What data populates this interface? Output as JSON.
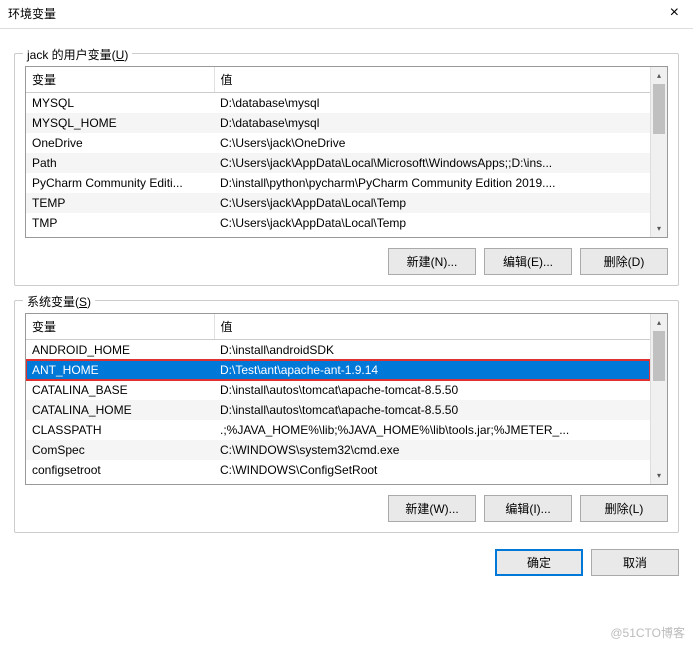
{
  "window": {
    "title": "环境变量",
    "close_label": "×"
  },
  "user_section": {
    "title_prefix": "jack 的用户变量(",
    "title_hotkey": "U",
    "title_suffix": ")",
    "headers": {
      "name": "变量",
      "value": "值"
    },
    "rows": [
      {
        "name": "MYSQL",
        "value": "D:\\database\\mysql"
      },
      {
        "name": "MYSQL_HOME",
        "value": "D:\\database\\mysql"
      },
      {
        "name": "OneDrive",
        "value": "C:\\Users\\jack\\OneDrive"
      },
      {
        "name": "Path",
        "value": "C:\\Users\\jack\\AppData\\Local\\Microsoft\\WindowsApps;;D:\\ins..."
      },
      {
        "name": "PyCharm Community Editi...",
        "value": "D:\\install\\python\\pycharm\\PyCharm Community Edition 2019...."
      },
      {
        "name": "TEMP",
        "value": "C:\\Users\\jack\\AppData\\Local\\Temp"
      },
      {
        "name": "TMP",
        "value": "C:\\Users\\jack\\AppData\\Local\\Temp"
      }
    ],
    "buttons": {
      "new": "新建(N)...",
      "edit": "编辑(E)...",
      "delete": "删除(D)"
    }
  },
  "system_section": {
    "title_prefix": "系统变量(",
    "title_hotkey": "S",
    "title_suffix": ")",
    "headers": {
      "name": "变量",
      "value": "值"
    },
    "rows": [
      {
        "name": "ANDROID_HOME",
        "value": "D:\\install\\androidSDK"
      },
      {
        "name": "ANT_HOME",
        "value": "D:\\Test\\ant\\apache-ant-1.9.14"
      },
      {
        "name": "CATALINA_BASE",
        "value": "D:\\install\\autos\\tomcat\\apache-tomcat-8.5.50"
      },
      {
        "name": "CATALINA_HOME",
        "value": "D:\\install\\autos\\tomcat\\apache-tomcat-8.5.50"
      },
      {
        "name": "CLASSPATH",
        "value": ".;%JAVA_HOME%\\lib;%JAVA_HOME%\\lib\\tools.jar;%JMETER_..."
      },
      {
        "name": "ComSpec",
        "value": "C:\\WINDOWS\\system32\\cmd.exe"
      },
      {
        "name": "configsetroot",
        "value": "C:\\WINDOWS\\ConfigSetRoot"
      }
    ],
    "selected_index": 1,
    "buttons": {
      "new": "新建(W)...",
      "edit": "编辑(I)...",
      "delete": "删除(L)"
    }
  },
  "footer": {
    "ok": "确定",
    "cancel": "取消"
  },
  "watermark": "@51CTO博客"
}
